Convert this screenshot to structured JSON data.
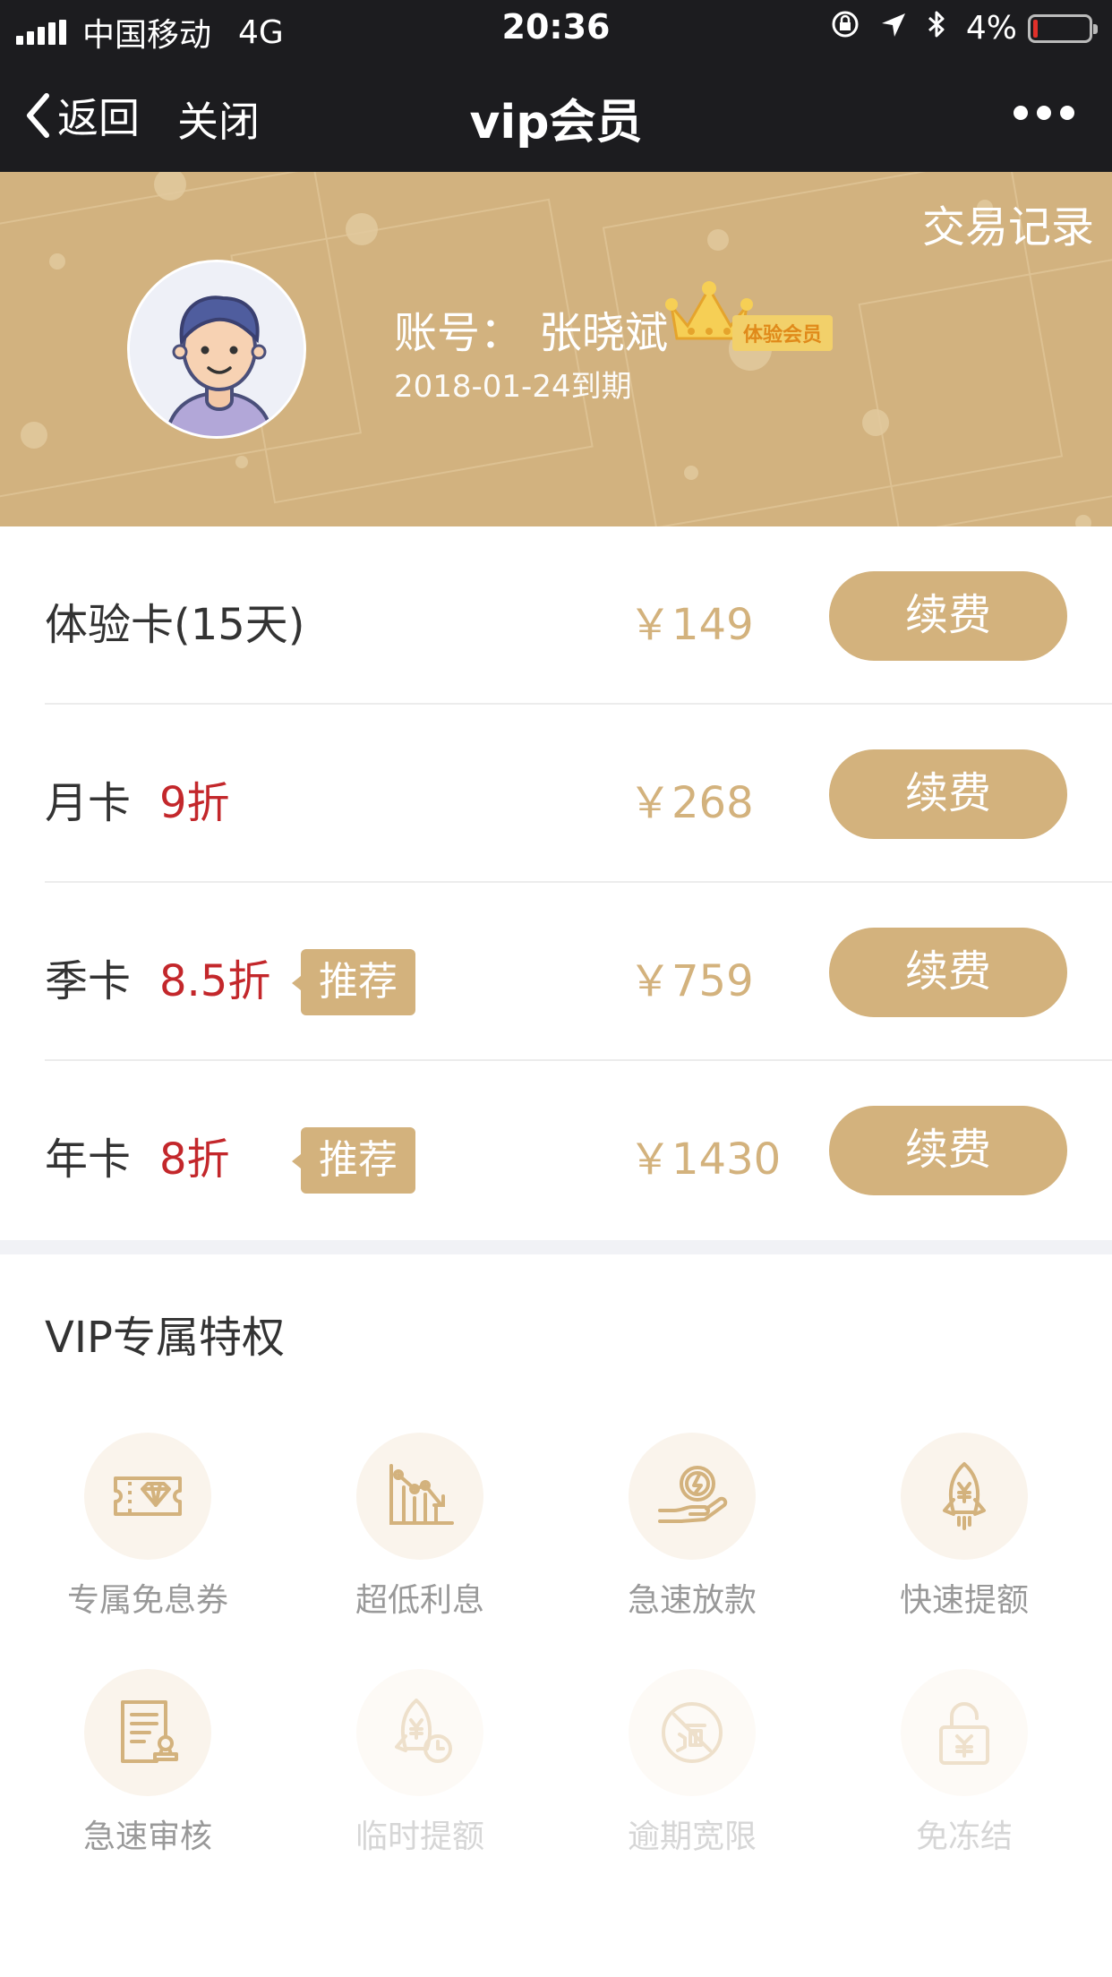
{
  "status_bar": {
    "carrier": "中国移动",
    "network": "4G",
    "time": "20:36",
    "battery": "4%",
    "battery_level": 0.04
  },
  "nav": {
    "back_label": "返回",
    "close_label": "关闭",
    "title": "vip会员"
  },
  "profile": {
    "transactions_link": "交易记录",
    "account_label": "账号：",
    "account_name": "张晓斌",
    "member_badge": "体验会员",
    "expiry": "2018-01-24到期"
  },
  "cards": [
    {
      "name": "体验卡(15天)",
      "discount": "",
      "recommend": "",
      "price": "￥149",
      "action": "续费"
    },
    {
      "name": "月卡",
      "discount": "9折",
      "recommend": "",
      "price": "￥268",
      "action": "续费"
    },
    {
      "name": "季卡",
      "discount": "8.5折",
      "recommend": "推荐",
      "price": "￥759",
      "action": "续费"
    },
    {
      "name": "年卡",
      "discount": "8折",
      "recommend": "推荐",
      "price": "￥1430",
      "action": "续费"
    }
  ],
  "privileges": {
    "title": "VIP专属特权",
    "items": [
      {
        "label": "专属免息券",
        "icon": "coupon-diamond-icon",
        "enabled": true
      },
      {
        "label": "超低利息",
        "icon": "bar-chart-decline-icon",
        "enabled": true
      },
      {
        "label": "急速放款",
        "icon": "hand-coin-icon",
        "enabled": true
      },
      {
        "label": "快速提额",
        "icon": "rocket-yuan-icon",
        "enabled": true
      },
      {
        "label": "急速审核",
        "icon": "document-stamp-icon",
        "enabled": true
      },
      {
        "label": "临时提额",
        "icon": "rocket-clock-icon",
        "enabled": false
      },
      {
        "label": "逾期宽限",
        "icon": "overdue-stamp-icon",
        "enabled": false
      },
      {
        "label": "免冻结",
        "icon": "unlock-yuan-icon",
        "enabled": false
      }
    ]
  },
  "colors": {
    "gold": "#d3b27d",
    "discount_red": "#c3272b",
    "nav_dark": "#1c1c1f",
    "hero_gold": "#d2b27f"
  }
}
